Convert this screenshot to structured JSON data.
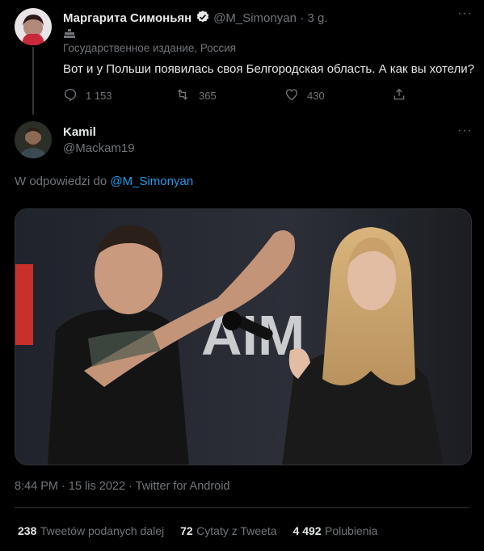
{
  "parent_tweet": {
    "display_name": "Маргарита Симоньян",
    "handle": "@M_Simonyan",
    "time": "· 3 g.",
    "state_label": "Государственное издание, Россия",
    "text": "Вот и у Польши появилась своя Белгородская область. А как вы хотели?",
    "replies": "1 153",
    "retweets": "365",
    "likes": "430"
  },
  "reply_tweet": {
    "display_name": "Kamil",
    "handle": "@Mackam19",
    "reply_prefix": "W odpowiedzi do",
    "reply_to": "@M_Simonyan",
    "timestamp": "8:44 PM · 15 lis 2022 · Twitter for Android"
  },
  "stats": {
    "retweets_count": "238",
    "retweets_label": "Tweetów podanych dalej",
    "quotes_count": "72",
    "quotes_label": "Cytaty z Tweeta",
    "likes_count": "4 492",
    "likes_label": "Polubienia"
  },
  "icons": {
    "more": "more-icon",
    "reply": "reply-icon",
    "retweet": "retweet-icon",
    "like": "heart-icon",
    "share": "share-icon",
    "verified": "verified-badge-icon",
    "state_media": "state-media-icon"
  },
  "colors": {
    "background": "#000000",
    "text": "#e7e9ea",
    "muted": "#71767b",
    "link": "#1d9bf0",
    "divider": "#2f3336"
  }
}
